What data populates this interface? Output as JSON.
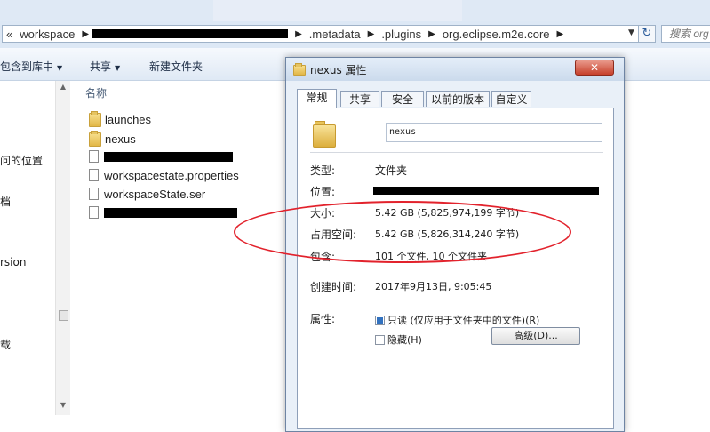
{
  "address": {
    "segments": [
      "workspace",
      ".metadata",
      ".plugins",
      "org.eclipse.m2e.core"
    ],
    "search_placeholder": "搜索 org"
  },
  "toolbar": {
    "include_library": "包含到库中",
    "share": "共享",
    "new_folder": "新建文件夹"
  },
  "nav": {
    "items": [
      "问的位置",
      "档",
      "rsion",
      "载"
    ]
  },
  "file_list": {
    "column_name": "名称",
    "items": [
      {
        "name": "launches",
        "kind": "folder"
      },
      {
        "name": "nexus",
        "kind": "folder"
      },
      {
        "name": "",
        "kind": "file"
      },
      {
        "name": "workspacestate.properties",
        "kind": "file"
      },
      {
        "name": "workspaceState.ser",
        "kind": "file"
      },
      {
        "name": "",
        "kind": "file"
      }
    ]
  },
  "dialog": {
    "title": "nexus 属性",
    "close_label": "✕",
    "tabs": [
      "常规",
      "共享",
      "安全",
      "以前的版本",
      "自定义"
    ],
    "active_tab": "常规",
    "name_value": "nexus",
    "type_label": "类型:",
    "type_value": "文件夹",
    "location_label": "位置:",
    "size_label": "大小:",
    "size_value": "5.42 GB (5,825,974,199 字节)",
    "disk_size_label": "占用空间:",
    "disk_size_value": "5.42 GB (5,826,314,240 字节)",
    "contains_label": "包含:",
    "contains_value": "101 个文件, 10 个文件夹",
    "created_label": "创建时间:",
    "created_value": "2017年9月13日, 9:05:45",
    "attributes_label": "属性:",
    "readonly_label": "只读 (仅应用于文件夹中的文件)(R)",
    "hidden_label": "隐藏(H)",
    "advanced_label": "高级(D)..."
  },
  "colors": {
    "annotation": "#e2222c",
    "redaction": "#000000"
  }
}
